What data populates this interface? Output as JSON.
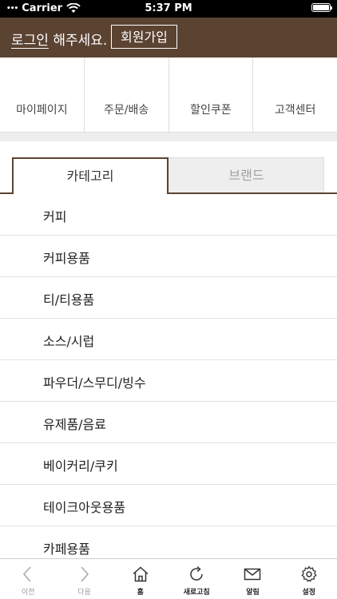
{
  "status_bar": {
    "carrier": "Carrier",
    "time": "5:37 PM",
    "battery_level": 1.0
  },
  "header": {
    "login_link": "로그인",
    "login_suffix": " 해주세요.",
    "signup_button": "회원가입",
    "background": "#5b4332"
  },
  "quick_menu": [
    {
      "label": "마이페이지"
    },
    {
      "label": "주문/배송"
    },
    {
      "label": "할인쿠폰"
    },
    {
      "label": "고객센터"
    }
  ],
  "tabs": [
    {
      "label": "카테고리",
      "selected": true
    },
    {
      "label": "브랜드",
      "selected": false
    }
  ],
  "categories": [
    "커피",
    "커피용품",
    "티/티용품",
    "소스/시럽",
    "파우더/스무디/빙수",
    "유제품/음료",
    "베이커리/쿠키",
    "테이크아웃용품",
    "카페용품"
  ],
  "toolbar": [
    {
      "label": "이전",
      "icon": "chevron-left-icon",
      "enabled": false
    },
    {
      "label": "다음",
      "icon": "chevron-right-icon",
      "enabled": false
    },
    {
      "label": "홈",
      "icon": "home-icon",
      "enabled": true
    },
    {
      "label": "새로고침",
      "icon": "refresh-icon",
      "enabled": true
    },
    {
      "label": "알림",
      "icon": "mail-icon",
      "enabled": true
    },
    {
      "label": "설정",
      "icon": "gear-icon",
      "enabled": true
    }
  ]
}
